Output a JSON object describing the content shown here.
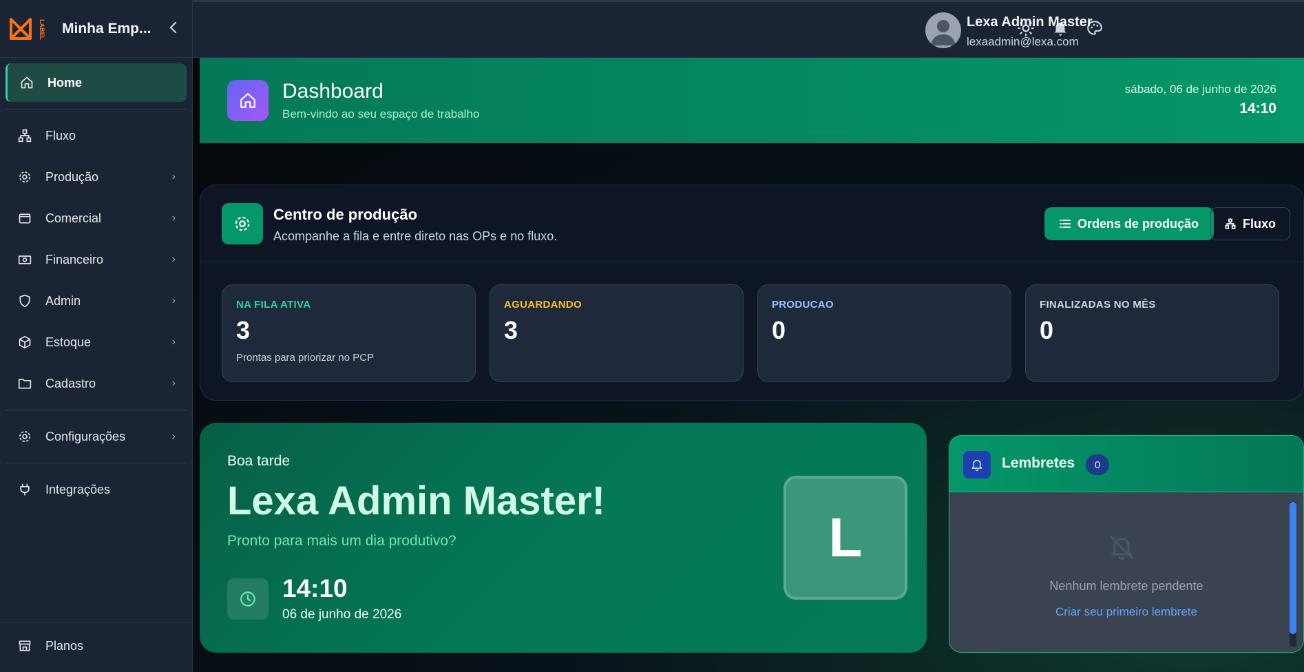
{
  "brand": {
    "name": "Minha Emp...",
    "logo_text": "LABEL"
  },
  "sidebar": {
    "items": [
      {
        "label": "Home",
        "icon": "home-icon",
        "active": true
      },
      {
        "label": "Fluxo",
        "icon": "flow-icon"
      },
      {
        "label": "Produção",
        "icon": "gear-icon"
      },
      {
        "label": "Comercial",
        "icon": "wallet-icon"
      },
      {
        "label": "Financeiro",
        "icon": "money-icon"
      },
      {
        "label": "Admin",
        "icon": "shield-icon"
      },
      {
        "label": "Estoque",
        "icon": "box-icon"
      },
      {
        "label": "Cadastro",
        "icon": "folder-icon"
      },
      {
        "label": "Configurações",
        "icon": "gear-icon"
      },
      {
        "label": "Integrações",
        "icon": "plug-icon"
      }
    ],
    "bottom": {
      "label": "Planos",
      "icon": "store-icon"
    }
  },
  "topbar": {
    "user_name": "Lexa Admin Master",
    "user_email": "lexaadmin@lexa.com"
  },
  "dashboard": {
    "title": "Dashboard",
    "subtitle": "Bem-vindo ao seu espaço de trabalho",
    "date": "sábado, 06 de junho de 2026",
    "time": "14:10"
  },
  "production": {
    "title": "Centro de produção",
    "subtitle": "Acompanhe a fila e entre direto nas OPs e no fluxo.",
    "btn_orders": "Ordens de produção",
    "btn_flow": "Fluxo",
    "stats": [
      {
        "label": "NA FILA ATIVA",
        "value": "3",
        "note": "Prontas para priorizar no PCP",
        "color": "#34d399"
      },
      {
        "label": "AGUARDANDO",
        "value": "3",
        "note": "",
        "color": "#fbbf24"
      },
      {
        "label": "PRODUCAO",
        "value": "0",
        "note": "",
        "color": "#93c5fd"
      },
      {
        "label": "FINALIZADAS NO MÊS",
        "value": "0",
        "note": "",
        "color": "#cbd5e1"
      }
    ]
  },
  "welcome": {
    "greeting": "Boa tarde",
    "name": "Lexa Admin Master!",
    "subtitle": "Pronto para mais um dia produtivo?",
    "time": "14:10",
    "date": "06 de junho de 2026",
    "initial": "L"
  },
  "reminders": {
    "title": "Lembretes",
    "count": "0",
    "empty_text": "Nenhum lembrete pendente",
    "create_link": "Criar seu primeiro lembrete"
  }
}
